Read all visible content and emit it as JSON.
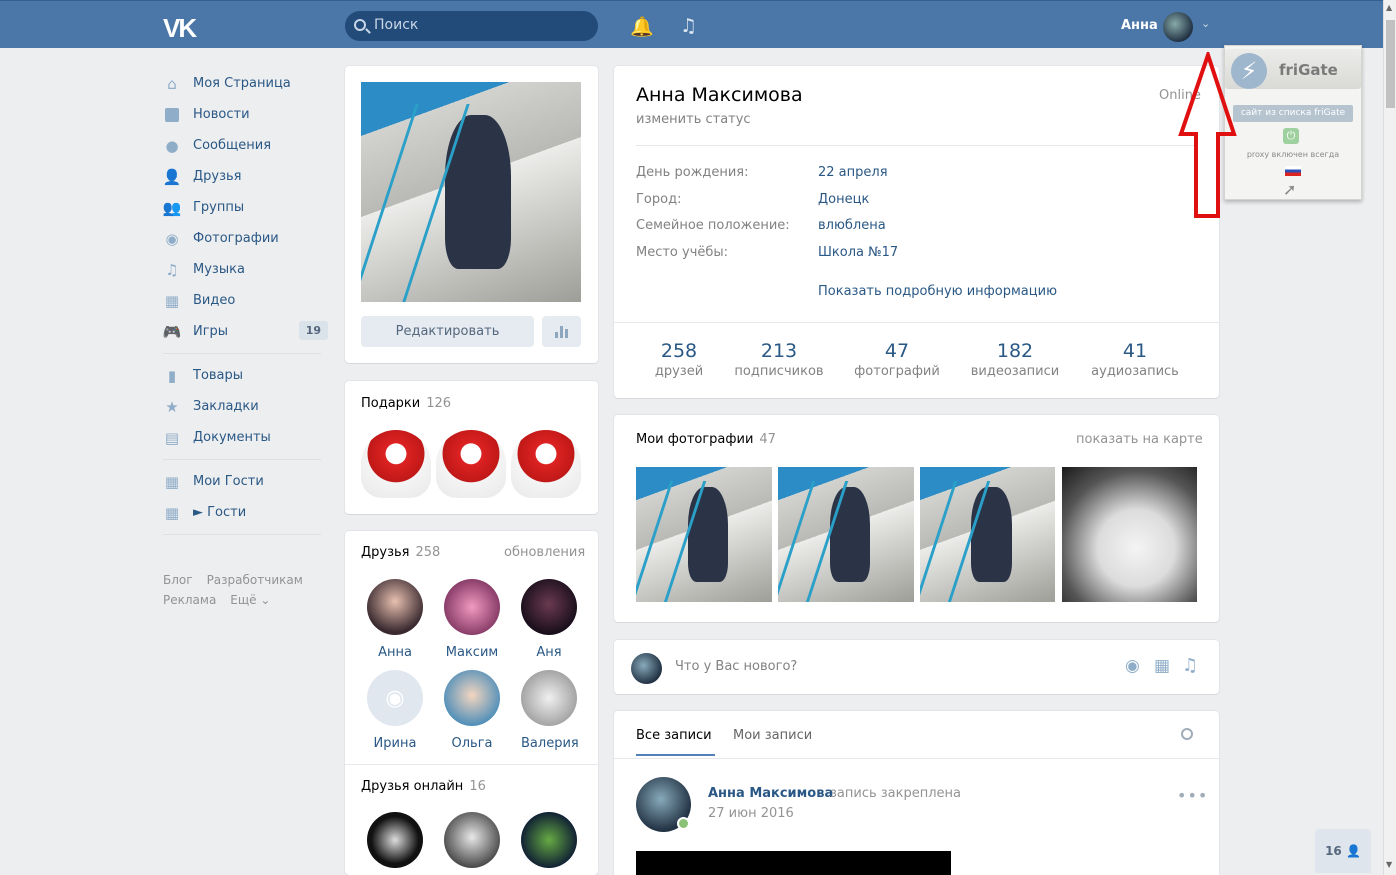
{
  "topbar": {
    "logo": "VK",
    "search_placeholder": "Поиск",
    "user_name": "Анна"
  },
  "sidebar": {
    "items": [
      {
        "label": "Моя Страница",
        "icon": "home-icon"
      },
      {
        "label": "Новости",
        "icon": "news-icon"
      },
      {
        "label": "Сообщения",
        "icon": "messages-icon"
      },
      {
        "label": "Друзья",
        "icon": "friends-icon"
      },
      {
        "label": "Группы",
        "icon": "groups-icon"
      },
      {
        "label": "Фотографии",
        "icon": "camera-icon"
      },
      {
        "label": "Музыка",
        "icon": "music-icon"
      },
      {
        "label": "Видео",
        "icon": "video-icon"
      },
      {
        "label": "Игры",
        "icon": "games-icon",
        "count": "19"
      },
      {
        "label": "Товары",
        "icon": "bag-icon"
      },
      {
        "label": "Закладки",
        "icon": "star-icon"
      },
      {
        "label": "Документы",
        "icon": "document-icon"
      },
      {
        "label": "Мои Гости",
        "icon": "grid-icon"
      },
      {
        "label": "► Гости",
        "icon": "grid-icon"
      }
    ],
    "footer": [
      "Блог",
      "Разработчикам",
      "Реклама",
      "Ещё ⌄"
    ]
  },
  "profile": {
    "edit_button": "Редактировать",
    "name": "Анна Максимова",
    "status": "изменить статус",
    "online": "Online",
    "info": [
      {
        "label": "День рождения:",
        "value": "22 апреля"
      },
      {
        "label": "Город:",
        "value": "Донецк"
      },
      {
        "label": "Семейное положение:",
        "value": "влюблена"
      },
      {
        "label": "Место учёбы:",
        "value": "Школа №17"
      }
    ],
    "more_info": "Показать подробную информацию",
    "stats": [
      {
        "num": "258",
        "label": "друзей"
      },
      {
        "num": "213",
        "label": "подписчиков"
      },
      {
        "num": "47",
        "label": "фотографий"
      },
      {
        "num": "182",
        "label": "видеозаписи"
      },
      {
        "num": "41",
        "label": "аудиозапись"
      }
    ]
  },
  "gifts": {
    "title": "Подарки",
    "count": "126"
  },
  "friends": {
    "title": "Друзья",
    "count": "258",
    "updates": "обновления",
    "list": [
      "Анна",
      "Максим",
      "Аня",
      "Ирина",
      "Ольга",
      "Валерия"
    ],
    "online_title": "Друзья онлайн",
    "online_count": "16"
  },
  "photos": {
    "title": "Мои фотографии",
    "count": "47",
    "map_link": "показать на карте"
  },
  "post_box": {
    "placeholder": "Что у Вас нового?"
  },
  "wall": {
    "tab_all": "Все записи",
    "tab_mine": "Мои записи",
    "author": "Анна Максимова",
    "pinned": "запись закреплена",
    "date": "27 июн 2016"
  },
  "frigate": {
    "title": "friGate",
    "badge": "сайт из списка friGate",
    "text": "proxy включен всегда"
  },
  "corner_badge": "16"
}
